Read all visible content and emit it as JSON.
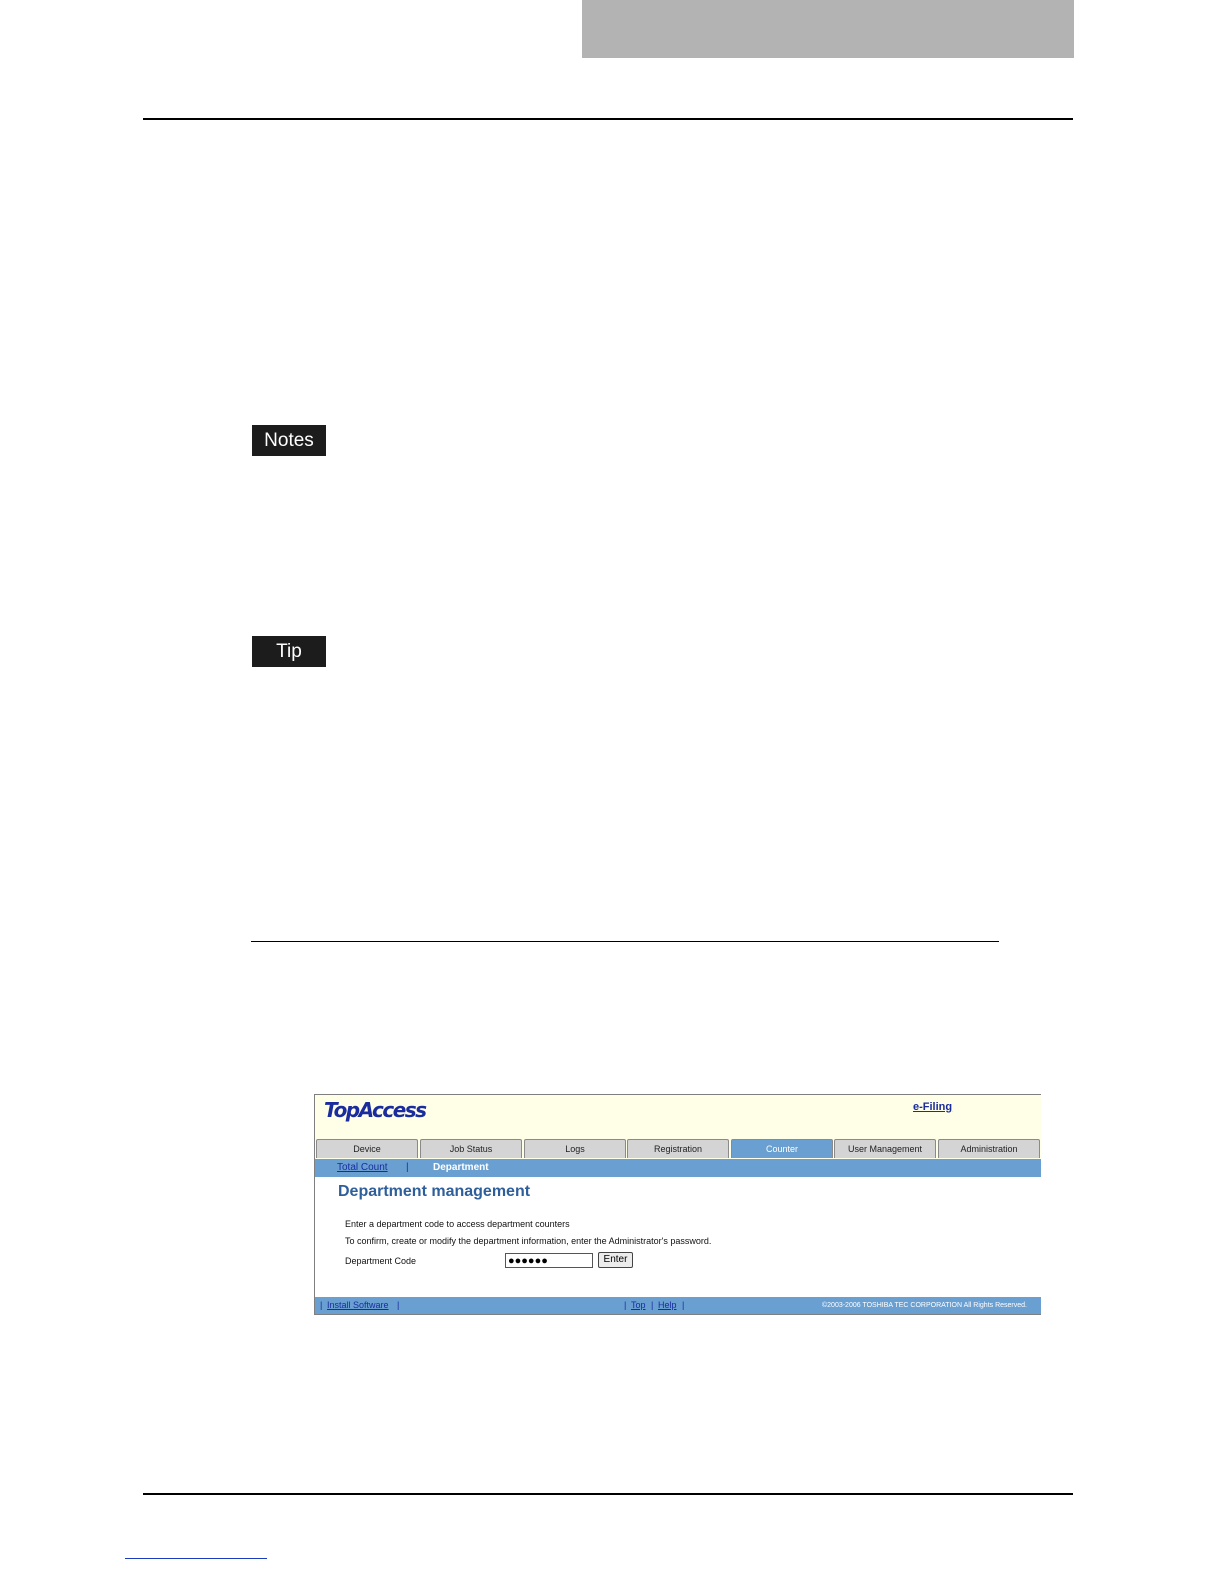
{
  "labels": {
    "notes": "Notes",
    "tip": "Tip"
  },
  "screenshot": {
    "logo": "TopAccess",
    "efiling": "e-Filing",
    "tabs": [
      "Device",
      "Job Status",
      "Logs",
      "Registration",
      "Counter",
      "User Management",
      "Administration"
    ],
    "active_tab": "Counter",
    "subnav": {
      "total_count": "Total Count",
      "separator": "|",
      "department": "Department"
    },
    "title": "Department management",
    "instruction1": "Enter a department code to access department counters",
    "instruction2": "To confirm, create or modify the department information, enter the Administrator's password.",
    "department_code_label": "Department Code",
    "department_code_value": "●●●●●●",
    "enter_button": "Enter",
    "footer": {
      "bar1": "|",
      "install_software": "Install Software",
      "bar2": "|",
      "bar3": "|",
      "top": "Top",
      "bar4": "|",
      "help": "Help",
      "bar5": "|",
      "copyright": "©2003-2006 TOSHIBA TEC CORPORATION All Rights Reserved."
    }
  }
}
